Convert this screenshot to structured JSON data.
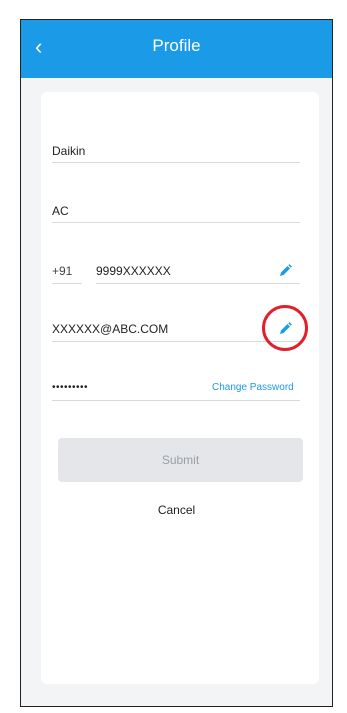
{
  "header": {
    "title": "Profile",
    "back_icon": "chevron-left-icon"
  },
  "form": {
    "first_name": "Daikin",
    "last_name": "AC",
    "phone_code": "+91",
    "phone": "9999XXXXXX",
    "email": "XXXXXX@ABC.COM",
    "password_mask": "•••••••••",
    "change_password_label": "Change  Password",
    "edit_icon": "pencil-icon"
  },
  "actions": {
    "submit_label": "Submit",
    "cancel_label": "Cancel"
  },
  "colors": {
    "accent": "#1b9ae8",
    "highlight": "#e0202a",
    "button_disabled": "#e4e6e9"
  }
}
